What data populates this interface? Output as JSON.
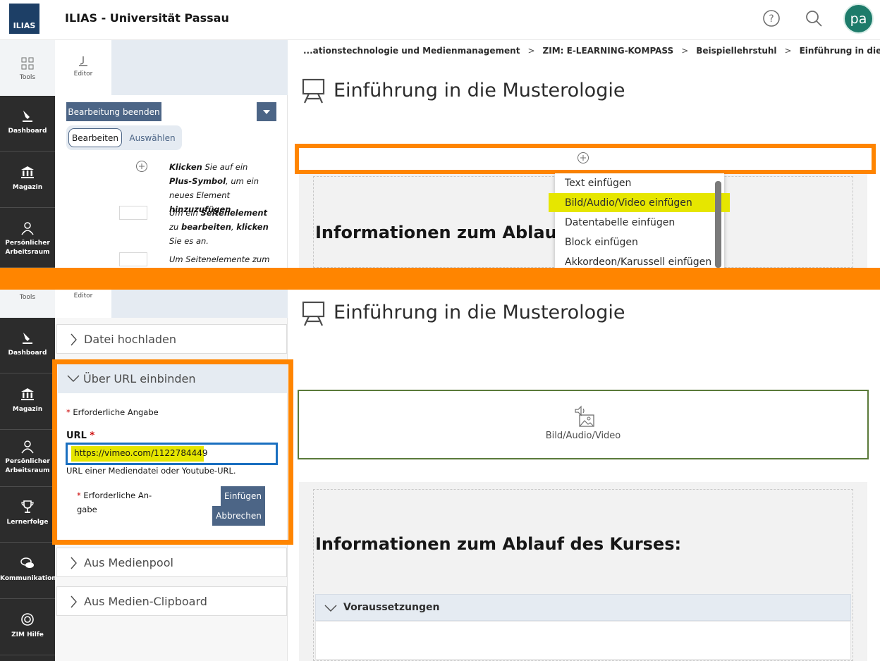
{
  "header": {
    "logo_text": "ILIAS",
    "title": "ILIAS - Universität Passau",
    "help_icon": "help-icon",
    "search_icon": "search-icon",
    "avatar_text": "pa"
  },
  "mainbar_top": {
    "tools_label": "Tools",
    "items": [
      {
        "label": "Dashboard",
        "icon": "dashboard-icon"
      },
      {
        "label": "Magazin",
        "icon": "magazin-icon"
      },
      {
        "label_line1": "Persönlicher",
        "label_line2": "Arbeitsraum",
        "icon": "user-icon"
      }
    ]
  },
  "mainbar_bottom": {
    "tools_label": "Tools",
    "items": [
      {
        "label": "Dashboard"
      },
      {
        "label": "Magazin"
      },
      {
        "label_line1": "Persönlicher",
        "label_line2": "Arbeitsraum"
      },
      {
        "label": "Lernerfolge"
      },
      {
        "label": "Kommunikation"
      },
      {
        "label": "ZIM Hilfe"
      }
    ]
  },
  "slate_top": {
    "editor_tab": "Editor",
    "end_edit_button": "Bearbeitung beenden",
    "mode_edit": "Bearbeiten",
    "mode_select": "Auswählen",
    "help1": {
      "b1": "Klicken",
      "t1": " Sie auf ein ",
      "b2": "Plus-Symbol",
      "t2": ", um ein neues Element ",
      "b3": "hinzuzufügen",
      "t3": "."
    },
    "help2": {
      "t1": "Um ein ",
      "b1": "Seitenelement",
      "t2": " zu ",
      "b2": "bearbeiten",
      "t3": ", ",
      "b3": "klicken",
      "t4": " Sie es an."
    },
    "help3": {
      "t1": "Um Seitenelemente zum"
    }
  },
  "slate_bottom": {
    "editor_tab": "Editor",
    "acc_upload": "Datei hochladen",
    "acc_url": "Über URL einbinden",
    "required_note": "Erforderliche Angabe",
    "url_label": "URL",
    "url_value": "https://vimeo.com/1122784449",
    "url_hint": "URL einer Mediendatei oder Youtube-URL.",
    "required_note2_line1": "Erforderliche An-",
    "required_note2_line2": "gabe",
    "insert_button": "Einfügen",
    "cancel_button": "Abbrechen",
    "acc_pool": "Aus Medienpool",
    "acc_clipboard": "Aus Medien-Clipboard"
  },
  "content_top": {
    "breadcrumb": [
      "...ationstechnologie und Medienmanagement",
      "ZIM: E-LEARNING-KOMPASS",
      "Beispiellehrstuhl",
      "Einführung in die Musterologie"
    ],
    "page_title": "Einführung in die Musterologie",
    "section_heading": "Informationen zum Ablauf d",
    "menu": [
      "Text einfügen",
      "Bild/Audio/Video einfügen",
      "Datentabelle einfügen",
      "Block einfügen",
      "Akkordeon/Karussell einfügen"
    ]
  },
  "content_bottom": {
    "page_title": "Einführung in die Musterologie",
    "media_placeholder": "Bild/Audio/Video",
    "section_heading": "Informationen zum Ablauf des Kurses:",
    "accordion_label": "Voraussetzungen"
  },
  "colors": {
    "highlight_orange": "#ff8500",
    "highlight_yellow": "#e6e600",
    "mainbar_dark": "#2c2c2c",
    "button_blue": "#4c6586",
    "media_border_green": "#5a7a3a"
  }
}
